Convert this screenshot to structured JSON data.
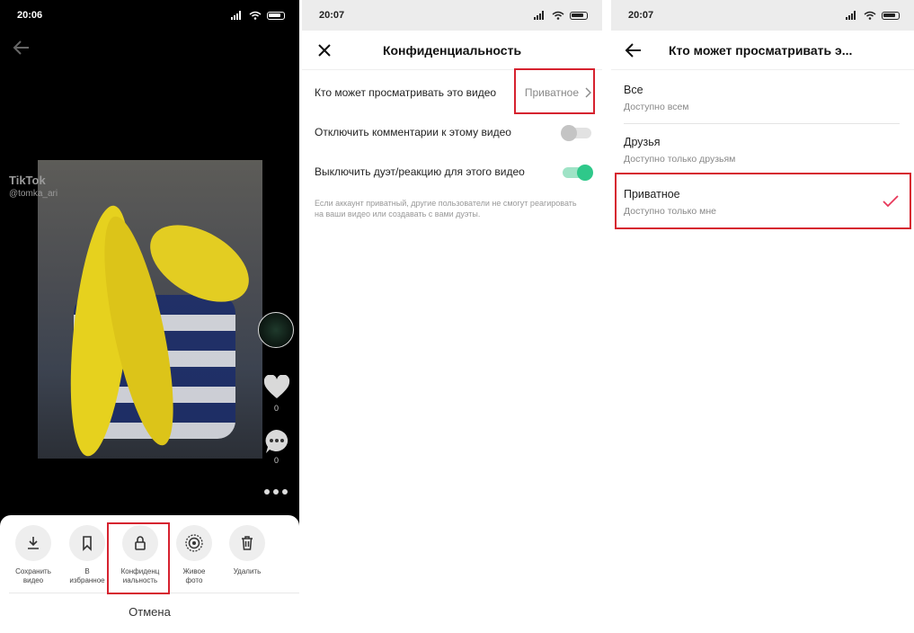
{
  "panel1": {
    "time": "20:06",
    "watermark": {
      "brand": "TikTok",
      "user": "@tomka_ari"
    },
    "like_count": "0",
    "comment_count": "0",
    "actions": [
      {
        "label": "Сохранить\nвидео",
        "icon": "download-icon"
      },
      {
        "label": "В\nизбранное",
        "icon": "bookmark-icon"
      },
      {
        "label": "Конфиденц\nиальность",
        "icon": "lock-icon"
      },
      {
        "label": "Живое\nфото",
        "icon": "live-photo-icon"
      },
      {
        "label": "Удалить",
        "icon": "trash-icon"
      }
    ],
    "cancel": "Отмена"
  },
  "panel2": {
    "time": "20:07",
    "title": "Конфиденциальность",
    "who_can_view": {
      "label": "Кто может просматривать это видео",
      "value": "Приватное"
    },
    "disable_comments": {
      "label": "Отключить комментарии к этому видео",
      "on": false
    },
    "disable_duet": {
      "label": "Выключить дуэт/реакцию для этого видео",
      "on": true
    },
    "note": "Если аккаунт приватный, другие пользователи не смогут реагировать на ваши видео или создавать с вами дуэты.",
    "accent_color": "#2fc88a"
  },
  "panel3": {
    "time": "20:07",
    "title": "Кто может просматривать э...",
    "options": [
      {
        "title": "Все",
        "subtitle": "Доступно всем",
        "selected": false
      },
      {
        "title": "Друзья",
        "subtitle": "Доступно только друзьям",
        "selected": false
      },
      {
        "title": "Приватное",
        "subtitle": "Доступно только мне",
        "selected": true
      }
    ],
    "check_color": "#e8385a"
  },
  "highlight_color": "#d6222f"
}
